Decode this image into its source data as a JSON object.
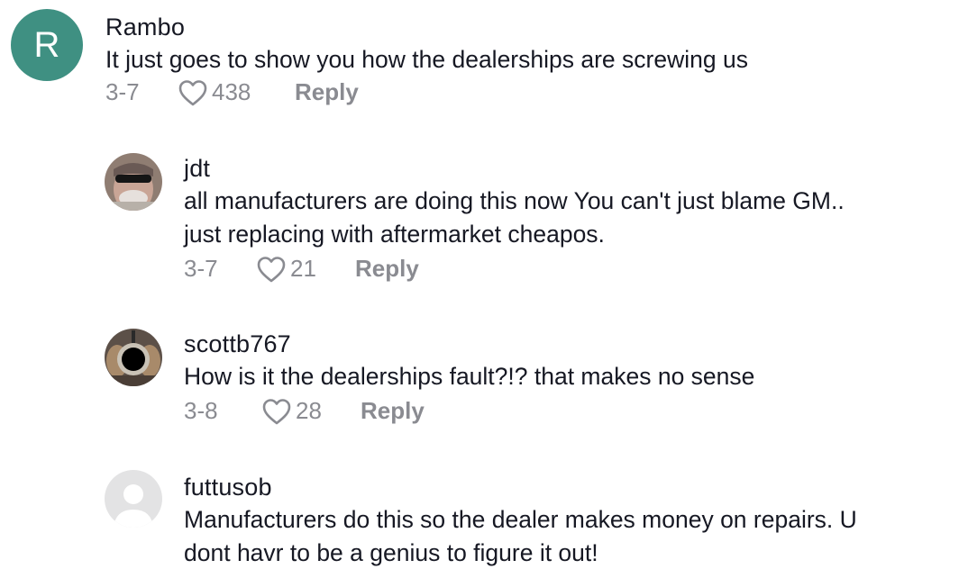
{
  "comments": [
    {
      "avatar_letter": "R",
      "avatar_color": "#3f9082",
      "username": "Rambo",
      "text_lines": [
        "It just goes to show you how the dealerships are screwing us"
      ],
      "date": "3-7",
      "likes": "438",
      "reply_label": "Reply"
    },
    {
      "username": "jdt",
      "text_lines": [
        "all manufacturers are doing this now You can't just blame GM..",
        "just replacing with aftermarket cheapos."
      ],
      "date": "3-7",
      "likes": "21",
      "reply_label": "Reply"
    },
    {
      "username": "scottb767",
      "text_lines": [
        "How is it the dealerships fault?!? that makes no sense"
      ],
      "date": "3-8",
      "likes": "28",
      "reply_label": "Reply"
    },
    {
      "username": "futtusob",
      "text_lines": [
        "Manufacturers do this so the dealer makes money on repairs. U",
        "dont havr to be a genius to figure it out!"
      ]
    }
  ]
}
